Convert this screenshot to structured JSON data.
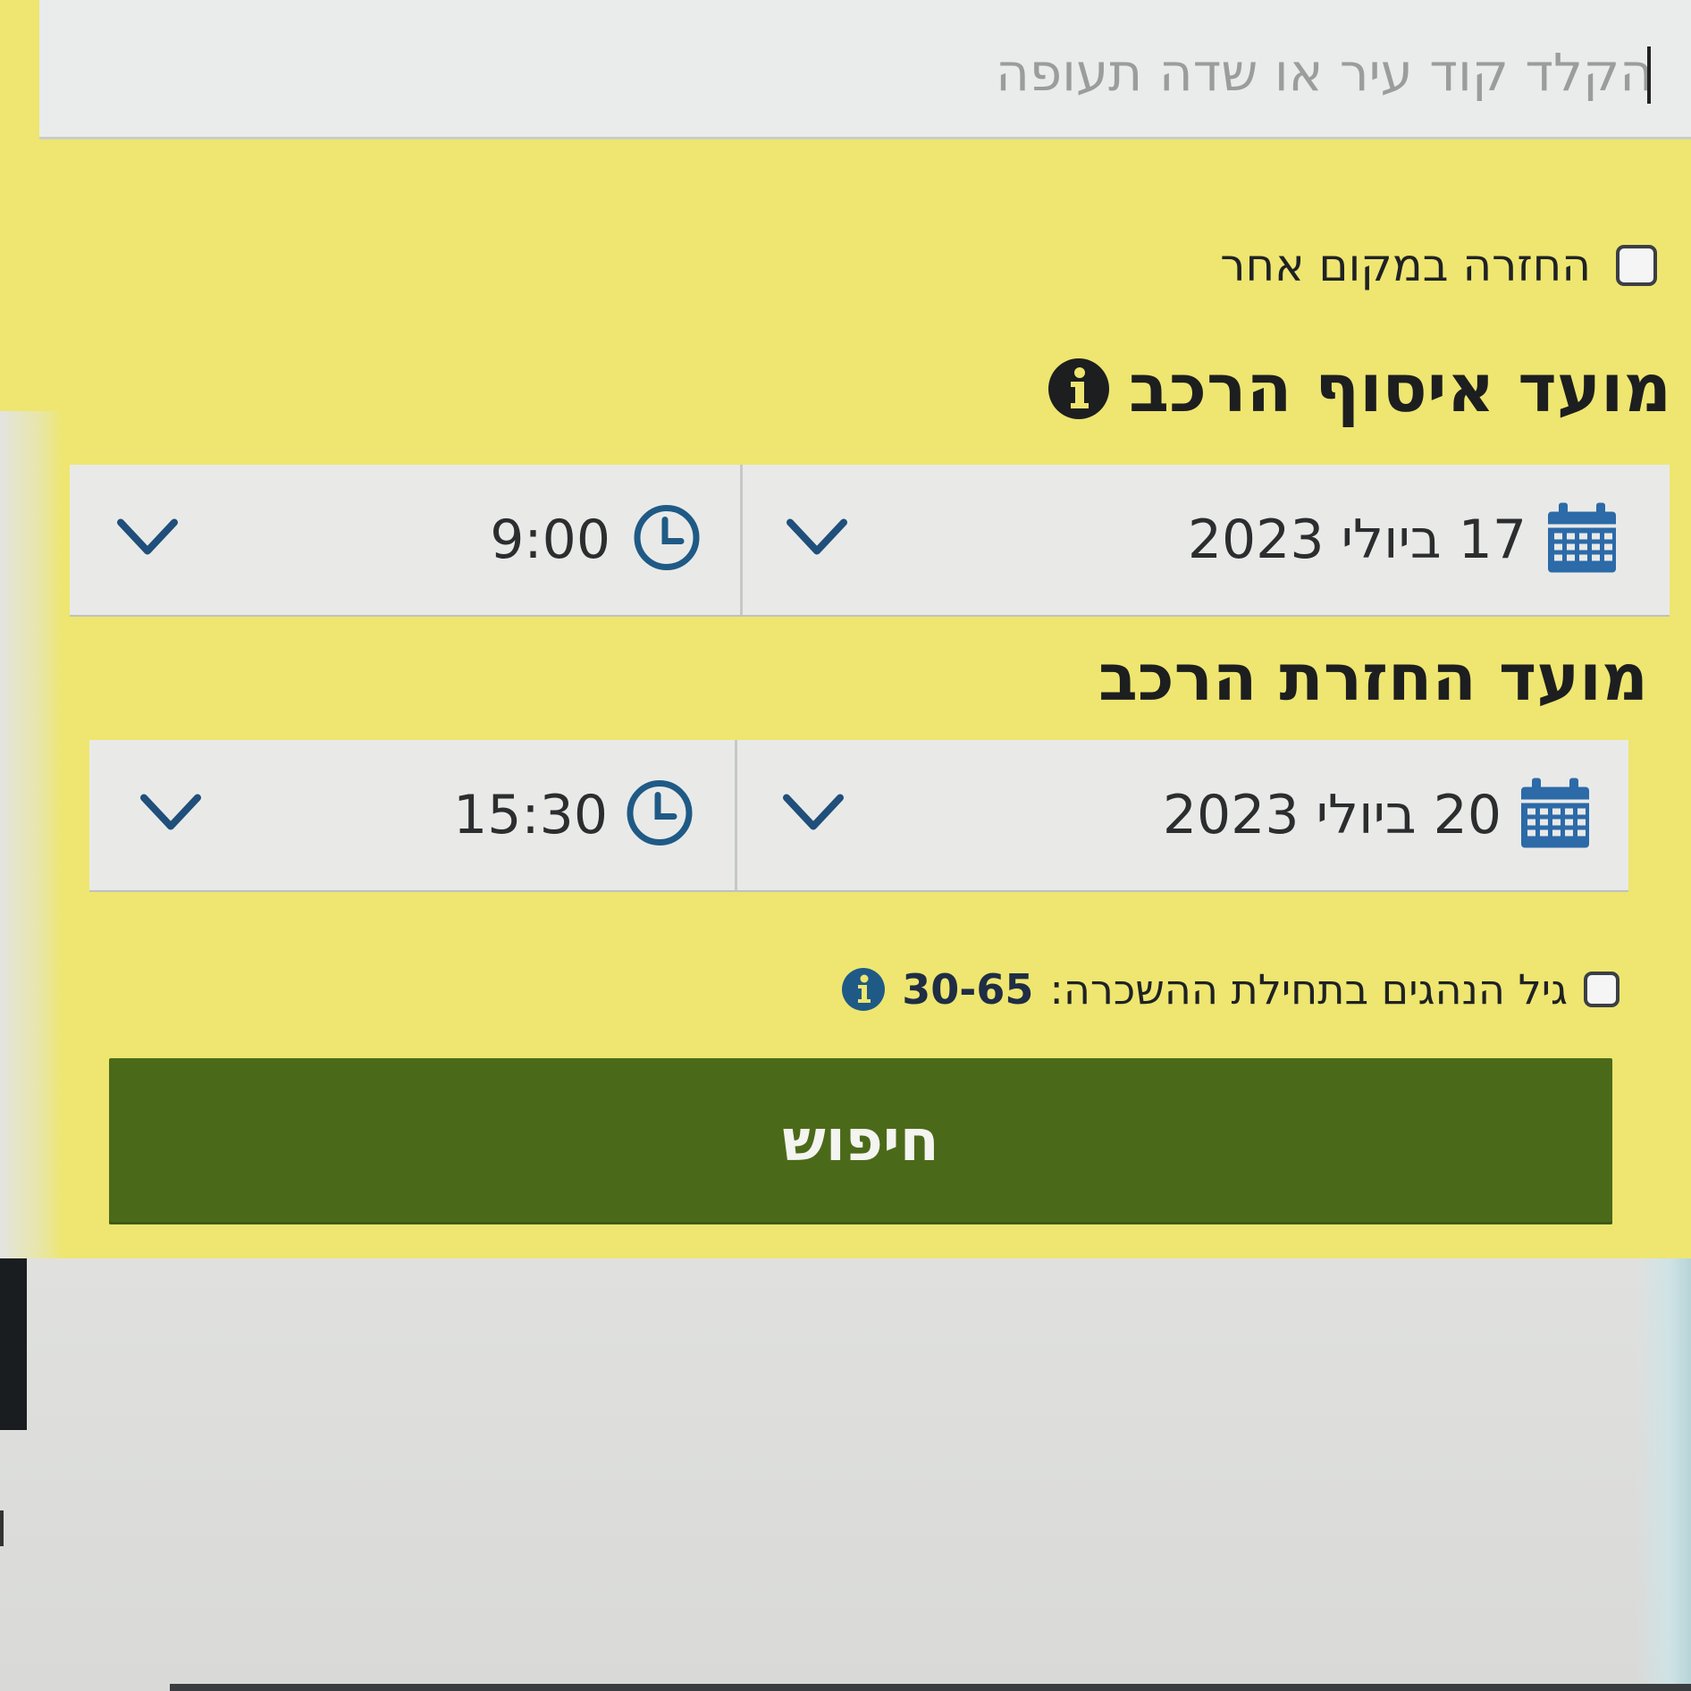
{
  "search": {
    "placeholder": "הקלד קוד עיר או שדה תעופה"
  },
  "return_elsewhere": {
    "label": "החזרה במקום אחר",
    "checked": false
  },
  "pickup": {
    "title": "מועד איסוף הרכב",
    "date": "17 ביולי 2023",
    "time": "9:00"
  },
  "dropoff": {
    "title": "מועד החזרת הרכב",
    "date": "20 ביולי 2023",
    "time": "15:30"
  },
  "driver_age": {
    "label": "גיל הנהגים בתחילת ההשכרה:",
    "value": "30-65",
    "checked": false
  },
  "search_button": {
    "label": "חיפוש"
  },
  "colors": {
    "panel": "#eee670",
    "button": "#4b6a19",
    "icon_blue": "#1f5a86",
    "calendar_blue": "#2c6aa8"
  }
}
